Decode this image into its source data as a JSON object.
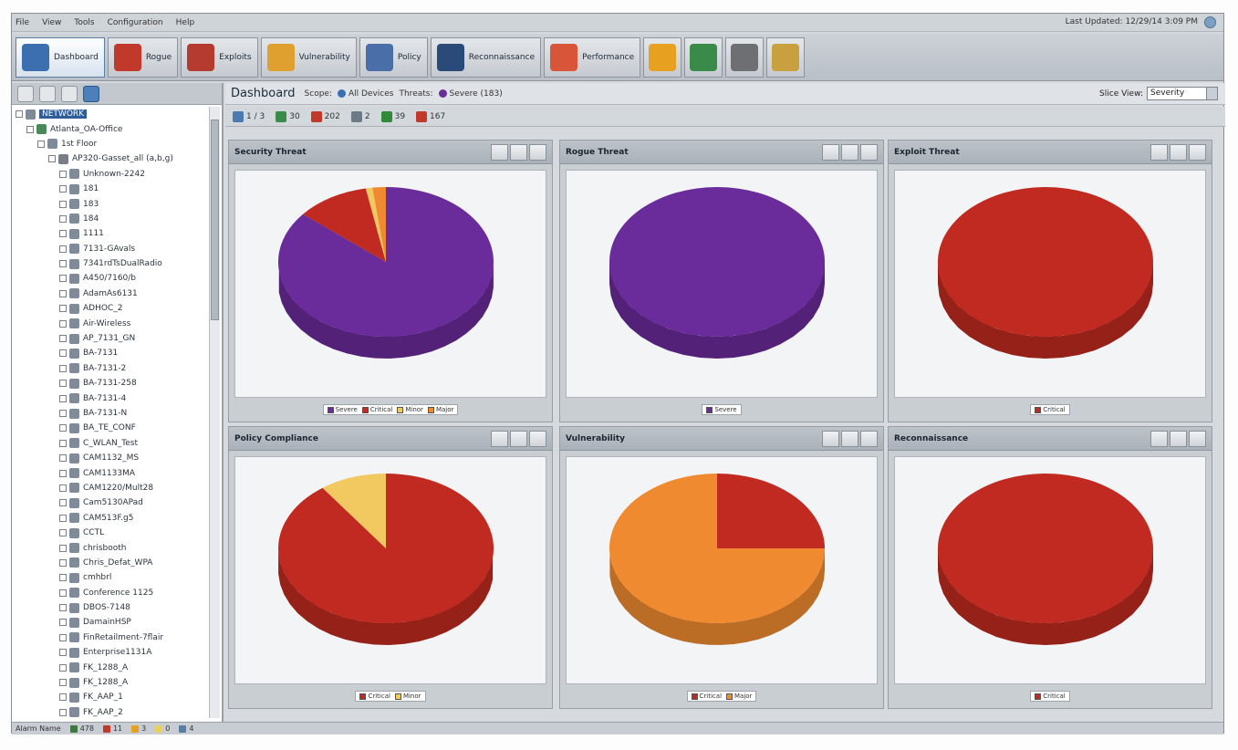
{
  "menu": [
    "File",
    "View",
    "Tools",
    "Configuration",
    "Help"
  ],
  "last_updated": "Last Updated: 12/29/14 3:09 PM",
  "toolbar": [
    {
      "name": "dashboard",
      "label": "Dashboard",
      "color": "#3c6fb0",
      "active": true
    },
    {
      "name": "rogue",
      "label": "Rogue",
      "color": "#c0392b"
    },
    {
      "name": "exploits",
      "label": "Exploits",
      "color": "#b53a2f"
    },
    {
      "name": "vulnerability",
      "label": "Vulnerability",
      "color": "#e0a030"
    },
    {
      "name": "policy",
      "label": "Policy",
      "color": "#4a6ea8"
    },
    {
      "name": "reconnaissance",
      "label": "Reconnaissance",
      "color": "#2a4a7a"
    },
    {
      "name": "performance",
      "label": "Performance",
      "color": "#d9553a"
    }
  ],
  "toolbar_icons": [
    {
      "name": "alarm-bell-icon",
      "color": "#e8a020"
    },
    {
      "name": "report-icon",
      "color": "#3a8a4a"
    },
    {
      "name": "settings-gear-icon",
      "color": "#6d6f72"
    },
    {
      "name": "search-icon",
      "color": "#c9a040"
    }
  ],
  "tree": [
    {
      "depth": 0,
      "label": "NETWORK",
      "selected": true
    },
    {
      "depth": 1,
      "label": "Atlanta_OA-Office"
    },
    {
      "depth": 2,
      "label": "1st Floor"
    },
    {
      "depth": 3,
      "label": "AP320-Gasset_all (a,b,g)"
    },
    {
      "depth": 4,
      "label": "Unknown-2242"
    },
    {
      "depth": 4,
      "label": "181"
    },
    {
      "depth": 4,
      "label": "183"
    },
    {
      "depth": 4,
      "label": "184"
    },
    {
      "depth": 4,
      "label": "1111"
    },
    {
      "depth": 4,
      "label": "7131-GAvals"
    },
    {
      "depth": 4,
      "label": "7341rdTsDualRadio"
    },
    {
      "depth": 4,
      "label": "A450/7160/b"
    },
    {
      "depth": 4,
      "label": "AdamAs6131"
    },
    {
      "depth": 4,
      "label": "ADHOC_2"
    },
    {
      "depth": 4,
      "label": "Air-Wireless"
    },
    {
      "depth": 4,
      "label": "AP_7131_GN"
    },
    {
      "depth": 4,
      "label": "BA-7131"
    },
    {
      "depth": 4,
      "label": "BA-7131-2"
    },
    {
      "depth": 4,
      "label": "BA-7131-258"
    },
    {
      "depth": 4,
      "label": "BA-7131-4"
    },
    {
      "depth": 4,
      "label": "BA-7131-N"
    },
    {
      "depth": 4,
      "label": "BA_TE_CONF"
    },
    {
      "depth": 4,
      "label": "C_WLAN_Test"
    },
    {
      "depth": 4,
      "label": "CAM1132_MS"
    },
    {
      "depth": 4,
      "label": "CAM1133MA"
    },
    {
      "depth": 4,
      "label": "CAM1220/Mult28"
    },
    {
      "depth": 4,
      "label": "Cam5130APad"
    },
    {
      "depth": 4,
      "label": "CAM513F.g5"
    },
    {
      "depth": 4,
      "label": "CCTL"
    },
    {
      "depth": 4,
      "label": "chrisbooth"
    },
    {
      "depth": 4,
      "label": "Chris_Defat_WPA"
    },
    {
      "depth": 4,
      "label": "cmhbrl"
    },
    {
      "depth": 4,
      "label": "Conference 1125"
    },
    {
      "depth": 4,
      "label": "DBOS-7148"
    },
    {
      "depth": 4,
      "label": "DamainHSP"
    },
    {
      "depth": 4,
      "label": "FinRetailment-7flair"
    },
    {
      "depth": 4,
      "label": "Enterprise1131A"
    },
    {
      "depth": 4,
      "label": "FK_1288_A"
    },
    {
      "depth": 4,
      "label": "FK_1288_A"
    },
    {
      "depth": 4,
      "label": "FK_AAP_1"
    },
    {
      "depth": 4,
      "label": "FK_AAP_2"
    }
  ],
  "status_bar": [
    {
      "label": "Alarm Name",
      "color": "#c8cdd3"
    },
    {
      "label": "478",
      "color": "#3a7a3a"
    },
    {
      "label": "11",
      "color": "#c0392b"
    },
    {
      "label": "3",
      "color": "#e8a020"
    },
    {
      "label": "0",
      "color": "#e8d060"
    },
    {
      "label": "4",
      "color": "#5a7da3"
    }
  ],
  "dashboard": {
    "title": "Dashboard",
    "scope_label": "Scope:",
    "scope_value": "All Devices",
    "threats_label": "Threats:",
    "threats_value": "Severe (183)",
    "view_label": "Slice View:",
    "view_value": "Severity"
  },
  "summary": [
    {
      "label": "1 / 3",
      "color": "#4a7ab0"
    },
    {
      "label": "30",
      "color": "#3a8a4a"
    },
    {
      "label": "202",
      "color": "#c0392b"
    },
    {
      "label": "2",
      "color": "#6d7a88"
    },
    {
      "label": "39",
      "color": "#2f8a3a"
    },
    {
      "label": "167",
      "color": "#c0392b"
    }
  ],
  "colors": {
    "severe": "#6a2c9a",
    "critical": "#c02a20",
    "major": "#f08a30",
    "minor": "#f2c860"
  },
  "panels": [
    {
      "title": "Security Threat",
      "chart_data": {
        "type": "pie",
        "slices": [
          {
            "name": "Severe",
            "value": 86,
            "color": "#6a2c9a"
          },
          {
            "name": "Critical",
            "value": 11,
            "color": "#c02a20"
          },
          {
            "name": "Minor",
            "value": 1,
            "color": "#f2c860"
          },
          {
            "name": "Major",
            "value": 2,
            "color": "#f08a30"
          }
        ]
      }
    },
    {
      "title": "Rogue Threat",
      "chart_data": {
        "type": "pie",
        "slices": [
          {
            "name": "Severe",
            "value": 100,
            "color": "#6a2c9a"
          }
        ]
      }
    },
    {
      "title": "Exploit Threat",
      "chart_data": {
        "type": "pie",
        "slices": [
          {
            "name": "Critical",
            "value": 100,
            "color": "#c02a20"
          }
        ]
      }
    },
    {
      "title": "Policy Compliance",
      "chart_data": {
        "type": "pie",
        "slices": [
          {
            "name": "Critical",
            "value": 90,
            "color": "#c02a20"
          },
          {
            "name": "Minor",
            "value": 10,
            "color": "#f2c860"
          }
        ]
      }
    },
    {
      "title": "Vulnerability",
      "chart_data": {
        "type": "pie",
        "slices": [
          {
            "name": "Critical",
            "value": 25,
            "color": "#c02a20"
          },
          {
            "name": "Major",
            "value": 75,
            "color": "#f08a30"
          }
        ]
      }
    },
    {
      "title": "Reconnaissance",
      "chart_data": {
        "type": "pie",
        "slices": [
          {
            "name": "Critical",
            "value": 100,
            "color": "#c02a20"
          }
        ]
      }
    }
  ]
}
